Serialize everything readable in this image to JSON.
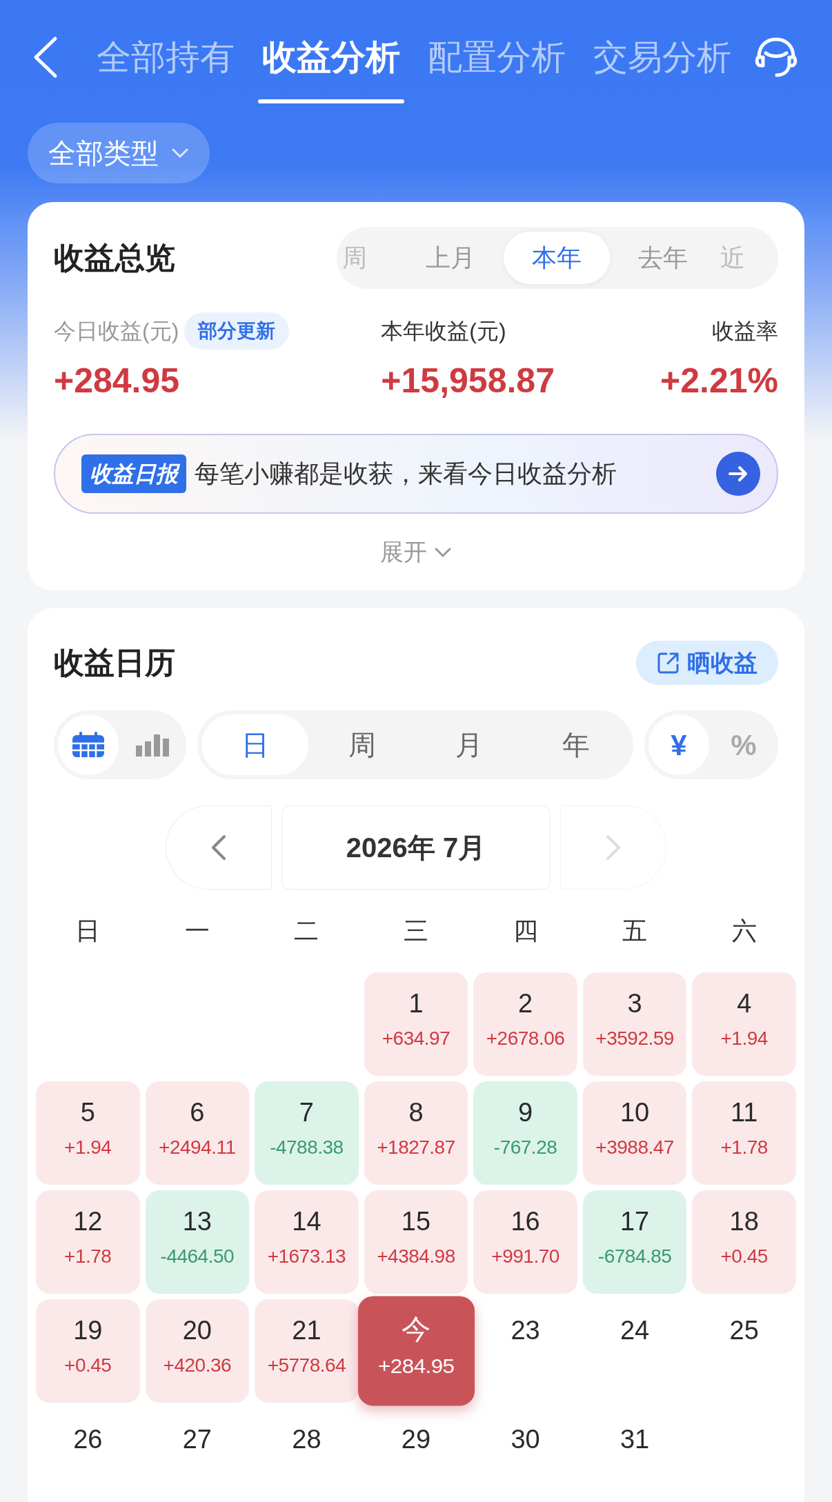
{
  "header": {
    "tabs": [
      {
        "label": "全部持有",
        "selected": false
      },
      {
        "label": "收益分析",
        "selected": true
      },
      {
        "label": "配置分析",
        "selected": false
      },
      {
        "label": "交易分析",
        "selected": false
      }
    ]
  },
  "type_filter": {
    "label": "全部类型"
  },
  "overview": {
    "title": "收益总览",
    "periods": [
      {
        "label": "周",
        "selected": false
      },
      {
        "label": "上月",
        "selected": false
      },
      {
        "label": "本年",
        "selected": true
      },
      {
        "label": "去年",
        "selected": false
      },
      {
        "label": "近",
        "selected": false
      }
    ],
    "metrics": [
      {
        "label": "今日收益(元)",
        "badge": "部分更新",
        "value": "+284.95"
      },
      {
        "label": "本年收益(元)",
        "value": "+15,958.87"
      },
      {
        "label": "收益率",
        "value": "+2.21%"
      }
    ],
    "report": {
      "tag": "收益日报",
      "text": "每笔小赚都是收获，来看今日收益分析"
    },
    "expand": "展开"
  },
  "calendar": {
    "title": "收益日历",
    "share": "晒收益",
    "views": [
      {
        "kind": "calendar",
        "selected": true
      },
      {
        "kind": "chart",
        "selected": false
      }
    ],
    "granularity": [
      {
        "label": "日",
        "selected": true
      },
      {
        "label": "周",
        "selected": false
      },
      {
        "label": "月",
        "selected": false
      },
      {
        "label": "年",
        "selected": false
      }
    ],
    "units": [
      {
        "label": "¥",
        "selected": true
      },
      {
        "label": "%",
        "selected": false
      }
    ],
    "prev": {
      "disabled": false
    },
    "next": {
      "disabled": true
    },
    "month": "2026年 7月",
    "weekdays": [
      "日",
      "一",
      "二",
      "三",
      "四",
      "五",
      "六"
    ],
    "weeks": [
      [
        {
          "day": "1",
          "amount": "+634.97",
          "kind": "gain"
        },
        {
          "day": "2",
          "amount": "+2678.06",
          "kind": "gain"
        },
        {
          "day": "3",
          "amount": "+3592.59",
          "kind": "gain"
        },
        {
          "day": "4",
          "amount": "+1.94",
          "kind": "gain"
        }
      ],
      [
        {
          "day": "5",
          "amount": "+1.94",
          "kind": "gain"
        },
        {
          "day": "6",
          "amount": "+2494.11",
          "kind": "gain"
        },
        {
          "day": "7",
          "amount": "-4788.38",
          "kind": "loss"
        },
        {
          "day": "8",
          "amount": "+1827.87",
          "kind": "gain"
        },
        {
          "day": "9",
          "amount": "-767.28",
          "kind": "loss"
        },
        {
          "day": "10",
          "amount": "+3988.47",
          "kind": "gain"
        },
        {
          "day": "11",
          "amount": "+1.78",
          "kind": "gain"
        }
      ],
      [
        {
          "day": "12",
          "amount": "+1.78",
          "kind": "gain"
        },
        {
          "day": "13",
          "amount": "-4464.50",
          "kind": "loss"
        },
        {
          "day": "14",
          "amount": "+1673.13",
          "kind": "gain"
        },
        {
          "day": "15",
          "amount": "+4384.98",
          "kind": "gain"
        },
        {
          "day": "16",
          "amount": "+991.70",
          "kind": "gain"
        },
        {
          "day": "17",
          "amount": "-6784.85",
          "kind": "loss"
        },
        {
          "day": "18",
          "amount": "+0.45",
          "kind": "gain"
        }
      ],
      [
        {
          "day": "19",
          "amount": "+0.45",
          "kind": "gain"
        },
        {
          "day": "20",
          "amount": "+420.36",
          "kind": "gain"
        },
        {
          "day": "21",
          "amount": "+5778.64",
          "kind": "gain"
        },
        {
          "day": "今",
          "amount": "+284.95",
          "kind": "today"
        },
        {
          "day": "23",
          "kind": "future"
        },
        {
          "day": "24",
          "kind": "future"
        },
        {
          "day": "25",
          "kind": "future"
        }
      ],
      [
        {
          "day": "26",
          "kind": "future"
        },
        {
          "day": "27",
          "kind": "future"
        },
        {
          "day": "28",
          "kind": "future"
        },
        {
          "day": "29",
          "kind": "future"
        },
        {
          "day": "30",
          "kind": "future"
        },
        {
          "day": "31",
          "kind": "future"
        }
      ]
    ]
  }
}
